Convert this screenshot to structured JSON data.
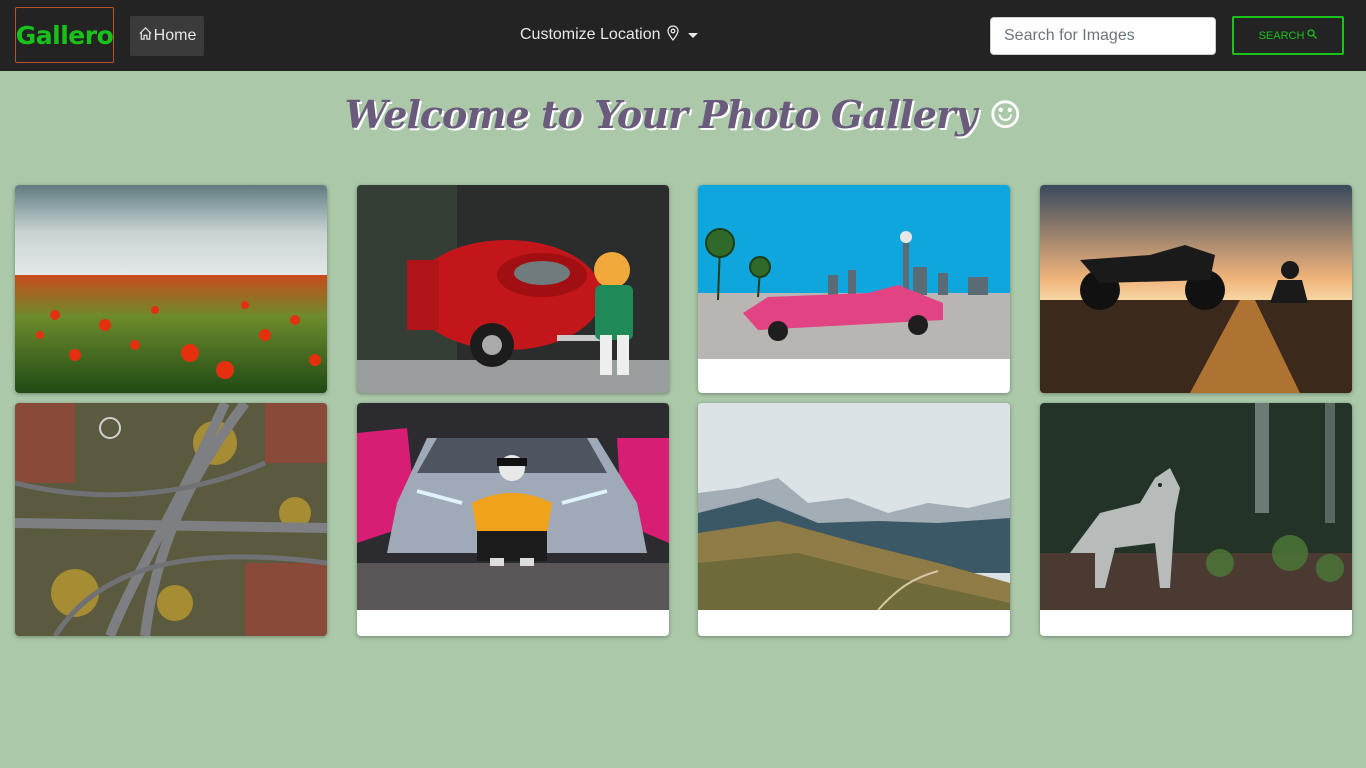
{
  "navbar": {
    "brand": "Gallero",
    "home_label": "Home",
    "location_label": "Customize Location",
    "search_placeholder": "Search for Images",
    "search_button_label": "SEARCH"
  },
  "title": "Welcome to Your Photo Gallery",
  "title_emoji": "☺",
  "gallery": [
    {
      "subject": "poppy-field"
    },
    {
      "subject": "red-beetle-toy"
    },
    {
      "subject": "pink-cadillac"
    },
    {
      "subject": "motorcycle-sunset"
    },
    {
      "subject": "highway-aerial"
    },
    {
      "subject": "sports-car-person"
    },
    {
      "subject": "mountains"
    },
    {
      "subject": "wolf"
    }
  ]
}
